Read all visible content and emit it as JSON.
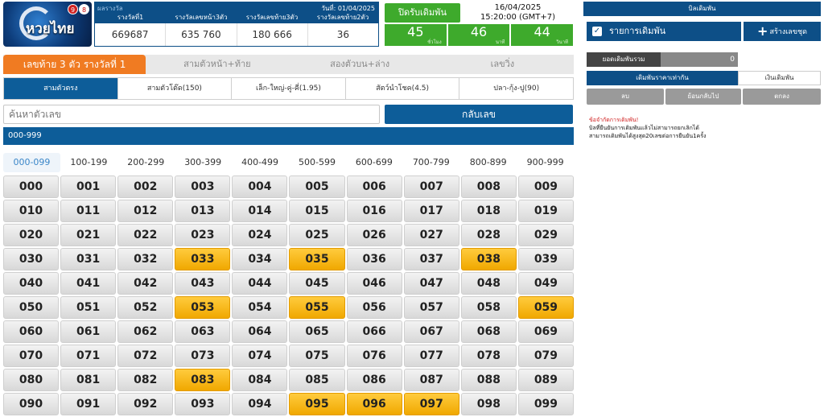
{
  "header": {
    "logo_text": "หวยไทย",
    "logo_balls": [
      "9",
      "8"
    ],
    "results_label": "ผลรางวัล",
    "draw_date": "วันที่: 01/04/2025",
    "result_columns": [
      "รางวัลที่1",
      "รางวัลเลขหน้า3ตัว",
      "รางวัลเลขท้าย3ตัว",
      "รางวัลเลขท้าย2ตัว"
    ],
    "result_values": [
      "669687",
      "635   760",
      "180   666",
      "36"
    ],
    "close_label": "ปิดรับเดิมพัน",
    "close_date": "16/04/2025",
    "close_time": "15:20:00 (GMT+7)",
    "countdown": [
      {
        "value": "45",
        "unit": "ชั่วโมง"
      },
      {
        "value": "46",
        "unit": "นาที"
      },
      {
        "value": "44",
        "unit": "วินาที"
      }
    ]
  },
  "main_tabs": [
    "เลขท้าย 3 ตัว รางวัลที่ 1",
    "สามตัวหน้า+ท้าย",
    "สองตัวบน+ล่าง",
    "เลขวิ่ง"
  ],
  "sub_tabs": [
    "สามตัวตรง",
    "สามตัวโต๊ด(150)",
    "เล็ก-ใหญ่-คู่-คี่(1.95)",
    "สัตว์นำโชค(4.5)",
    "ปลา-กุ้ง-ปู(90)"
  ],
  "search": {
    "placeholder": "ค้นหาตัวเลข"
  },
  "reverse_label": "กลับเลข",
  "range_bar": "000-999",
  "range_tabs": [
    "000-099",
    "100-199",
    "200-299",
    "300-399",
    "400-499",
    "500-599",
    "600-699",
    "700-799",
    "800-899",
    "900-999"
  ],
  "numbers": {
    "rows": [
      [
        "000",
        "001",
        "002",
        "003",
        "004",
        "005",
        "006",
        "007",
        "008",
        "009"
      ],
      [
        "010",
        "011",
        "012",
        "013",
        "014",
        "015",
        "016",
        "017",
        "018",
        "019"
      ],
      [
        "020",
        "021",
        "022",
        "023",
        "024",
        "025",
        "026",
        "027",
        "028",
        "029"
      ],
      [
        "030",
        "031",
        "032",
        "033",
        "034",
        "035",
        "036",
        "037",
        "038",
        "039"
      ],
      [
        "040",
        "041",
        "042",
        "043",
        "044",
        "045",
        "046",
        "047",
        "048",
        "049"
      ],
      [
        "050",
        "051",
        "052",
        "053",
        "054",
        "055",
        "056",
        "057",
        "058",
        "059"
      ],
      [
        "060",
        "061",
        "062",
        "063",
        "064",
        "065",
        "066",
        "067",
        "068",
        "069"
      ],
      [
        "070",
        "071",
        "072",
        "073",
        "074",
        "075",
        "076",
        "077",
        "078",
        "079"
      ],
      [
        "080",
        "081",
        "082",
        "083",
        "084",
        "085",
        "086",
        "087",
        "088",
        "089"
      ],
      [
        "090",
        "091",
        "092",
        "093",
        "094",
        "095",
        "096",
        "097",
        "098",
        "099"
      ]
    ],
    "selected": [
      "033",
      "035",
      "038",
      "053",
      "055",
      "059",
      "083",
      "095",
      "096",
      "097"
    ]
  },
  "right_panel": {
    "title": "บิลเดิมพัน",
    "list_label": "รายการเดิมพัน",
    "create_label": "สร้างเลขชุด",
    "total_label": "ยอดเดิมพันรวม",
    "total_value": "0",
    "equal_label": "เดิมพันราคาเท่ากัน",
    "amount_label": "เงินเดิมพัน",
    "clear_label": "ลบ",
    "undo_label": "ย้อนกลับไป",
    "confirm_label": "ตกลง",
    "notes_title": "ข้อจำกัดการเดิมพัน!",
    "note_1": "บิลที่ยืนยันการเดิมพันแล้วไม่สามารถยกเลิกได้",
    "note_2": "สามารถเดิมพันได้สูงสุด20เลขต่อการยืนยัน1ครั้ง"
  },
  "colors": {
    "selected": "#f0a800",
    "primary": "#0d5d99",
    "tab_active": "#f07b22",
    "countdown": "#3eaa2c"
  }
}
